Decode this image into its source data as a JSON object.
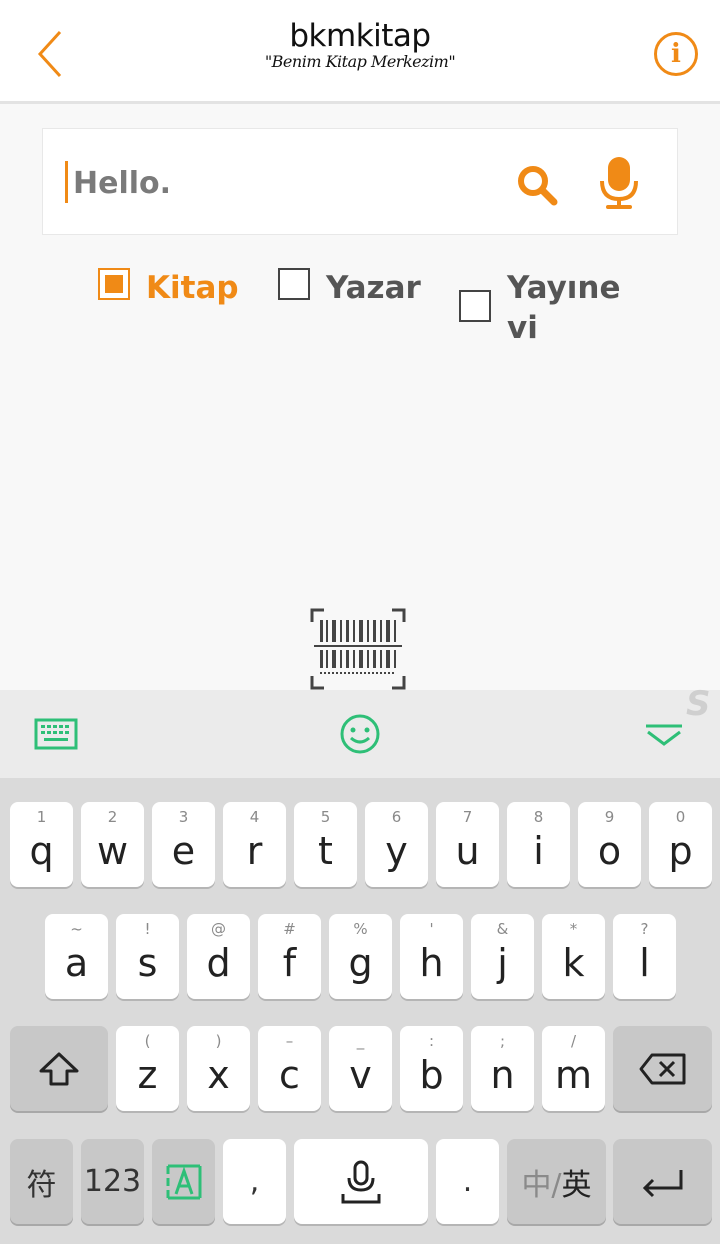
{
  "header": {
    "brand_name": "bkmkitap",
    "slogan": "\"Benim Kitap Merkezim\""
  },
  "search": {
    "value": "Hello.",
    "placeholder": ""
  },
  "filters": [
    {
      "label": "Kitap",
      "checked": true
    },
    {
      "label": "Yazar",
      "checked": false
    },
    {
      "label_line1": "Yayıne",
      "label_line2": "vi",
      "checked": false
    }
  ],
  "keyboard": {
    "row1": [
      {
        "hint": "1",
        "key": "q"
      },
      {
        "hint": "2",
        "key": "w"
      },
      {
        "hint": "3",
        "key": "e"
      },
      {
        "hint": "4",
        "key": "r"
      },
      {
        "hint": "5",
        "key": "t"
      },
      {
        "hint": "6",
        "key": "y"
      },
      {
        "hint": "7",
        "key": "u"
      },
      {
        "hint": "8",
        "key": "i"
      },
      {
        "hint": "9",
        "key": "o"
      },
      {
        "hint": "0",
        "key": "p"
      }
    ],
    "row2": [
      {
        "hint": "~",
        "key": "a"
      },
      {
        "hint": "!",
        "key": "s"
      },
      {
        "hint": "@",
        "key": "d"
      },
      {
        "hint": "#",
        "key": "f"
      },
      {
        "hint": "%",
        "key": "g"
      },
      {
        "hint": "'",
        "key": "h"
      },
      {
        "hint": "&",
        "key": "j"
      },
      {
        "hint": "*",
        "key": "k"
      },
      {
        "hint": "?",
        "key": "l"
      }
    ],
    "row3": [
      {
        "hint": "(",
        "key": "z"
      },
      {
        "hint": ")",
        "key": "x"
      },
      {
        "hint": "–",
        "key": "c"
      },
      {
        "hint": "_",
        "key": "v"
      },
      {
        "hint": ":",
        "key": "b"
      },
      {
        "hint": ";",
        "key": "n"
      },
      {
        "hint": "/",
        "key": "m"
      }
    ],
    "symbols_label": "符",
    "numbers_label": "123",
    "comma_label": ",",
    "period_label": ".",
    "lang_label_a": "中/",
    "lang_label_b": "英",
    "swype_mark": "S"
  },
  "colors": {
    "accent": "#f08a16",
    "keyboard_green": "#2ebf77"
  }
}
